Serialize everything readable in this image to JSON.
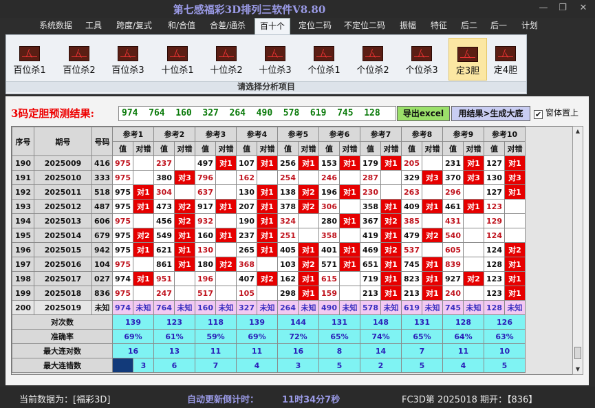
{
  "window": {
    "title": "第七感福彩3D排列三软件V8.80"
  },
  "menu": [
    "系统数据",
    "工具",
    "跨度/复式",
    "和/合值",
    "合差/通杀",
    "百十个",
    "定位二码",
    "不定位二码",
    "振幅",
    "特征",
    "后二",
    "后一",
    "计划"
  ],
  "ribbon": {
    "buttons": [
      "百位杀1",
      "百位杀2",
      "百位杀3",
      "十位杀1",
      "十位杀2",
      "十位杀3",
      "个位杀1",
      "个位杀2",
      "个位杀3",
      "定3胆",
      "定4胆"
    ],
    "caption": "请选择分析项目"
  },
  "prediction": {
    "label": "3码定胆预测结果:",
    "value": "974  764  160  327  264  490  578  619  745  128",
    "excel_button": "导出excel",
    "generate_button": "用结果>生成大底",
    "checkbox_label": "窗体置上",
    "checkbox_checked": true
  },
  "table": {
    "col_headers": [
      "序号",
      "期号",
      "号码"
    ],
    "ref_headers": [
      "参考1",
      "参考2",
      "参考3",
      "参考4",
      "参考5",
      "参考6",
      "参考7",
      "参考8",
      "参考9",
      "参考10"
    ],
    "sub_headers": [
      "值",
      "对错"
    ],
    "rows": [
      {
        "seq": "190",
        "issue": "2025009",
        "num": "416",
        "cells": [
          [
            "975",
            "",
            "r"
          ],
          [
            "237",
            "",
            "r"
          ],
          [
            "497",
            "对1",
            "b"
          ],
          [
            "107",
            "对1",
            "b"
          ],
          [
            "256",
            "对1",
            "b"
          ],
          [
            "153",
            "对1",
            "b"
          ],
          [
            "179",
            "对1",
            "b"
          ],
          [
            "205",
            "",
            "r"
          ],
          [
            "231",
            "对1",
            "b"
          ],
          [
            "127",
            "对1",
            "b"
          ]
        ]
      },
      {
        "seq": "191",
        "issue": "2025010",
        "num": "333",
        "cells": [
          [
            "975",
            "",
            "r"
          ],
          [
            "380",
            "对3",
            "b"
          ],
          [
            "796",
            "",
            "r"
          ],
          [
            "162",
            "",
            "r"
          ],
          [
            "254",
            "",
            "r"
          ],
          [
            "246",
            "",
            "r"
          ],
          [
            "287",
            "",
            "r"
          ],
          [
            "329",
            "对3",
            "b"
          ],
          [
            "370",
            "对3",
            "b"
          ],
          [
            "130",
            "对3",
            "b"
          ]
        ]
      },
      {
        "seq": "192",
        "issue": "2025011",
        "num": "518",
        "cells": [
          [
            "975",
            "对1",
            "b"
          ],
          [
            "304",
            "",
            "r"
          ],
          [
            "637",
            "",
            "r"
          ],
          [
            "130",
            "对1",
            "b"
          ],
          [
            "138",
            "对2",
            "b"
          ],
          [
            "196",
            "对1",
            "b"
          ],
          [
            "230",
            "",
            "r"
          ],
          [
            "263",
            "",
            "r"
          ],
          [
            "296",
            "",
            "r"
          ],
          [
            "127",
            "对1",
            "b"
          ]
        ]
      },
      {
        "seq": "193",
        "issue": "2025012",
        "num": "487",
        "cells": [
          [
            "975",
            "对1",
            "b"
          ],
          [
            "473",
            "对2",
            "b"
          ],
          [
            "917",
            "对1",
            "b"
          ],
          [
            "207",
            "对1",
            "b"
          ],
          [
            "378",
            "对2",
            "b"
          ],
          [
            "306",
            "",
            "r"
          ],
          [
            "358",
            "对1",
            "b"
          ],
          [
            "409",
            "对1",
            "b"
          ],
          [
            "461",
            "对1",
            "b"
          ],
          [
            "123",
            "",
            "r"
          ]
        ]
      },
      {
        "seq": "194",
        "issue": "2025013",
        "num": "606",
        "cells": [
          [
            "975",
            "",
            "r"
          ],
          [
            "456",
            "对2",
            "b"
          ],
          [
            "932",
            "",
            "r"
          ],
          [
            "190",
            "对1",
            "b"
          ],
          [
            "324",
            "",
            "r"
          ],
          [
            "280",
            "对1",
            "b"
          ],
          [
            "367",
            "对2",
            "b"
          ],
          [
            "385",
            "",
            "r"
          ],
          [
            "431",
            "",
            "r"
          ],
          [
            "129",
            "",
            "r"
          ]
        ]
      },
      {
        "seq": "195",
        "issue": "2025014",
        "num": "679",
        "cells": [
          [
            "975",
            "对2",
            "b"
          ],
          [
            "549",
            "对1",
            "b"
          ],
          [
            "160",
            "对1",
            "b"
          ],
          [
            "237",
            "对1",
            "b"
          ],
          [
            "251",
            "",
            "r"
          ],
          [
            "358",
            "",
            "r"
          ],
          [
            "419",
            "对1",
            "b"
          ],
          [
            "479",
            "对2",
            "b"
          ],
          [
            "540",
            "",
            "r"
          ],
          [
            "124",
            "",
            "r"
          ]
        ]
      },
      {
        "seq": "196",
        "issue": "2025015",
        "num": "942",
        "cells": [
          [
            "975",
            "对1",
            "b"
          ],
          [
            "621",
            "对1",
            "b"
          ],
          [
            "130",
            "",
            "r"
          ],
          [
            "265",
            "对1",
            "b"
          ],
          [
            "405",
            "对1",
            "b"
          ],
          [
            "401",
            "对1",
            "b"
          ],
          [
            "469",
            "对2",
            "b"
          ],
          [
            "537",
            "",
            "r"
          ],
          [
            "605",
            "",
            "r"
          ],
          [
            "124",
            "对2",
            "b"
          ]
        ]
      },
      {
        "seq": "197",
        "issue": "2025016",
        "num": "104",
        "cells": [
          [
            "975",
            "",
            "r"
          ],
          [
            "861",
            "对1",
            "b"
          ],
          [
            "180",
            "对2",
            "b"
          ],
          [
            "368",
            "",
            "r"
          ],
          [
            "103",
            "对2",
            "b"
          ],
          [
            "571",
            "对1",
            "b"
          ],
          [
            "651",
            "对1",
            "b"
          ],
          [
            "745",
            "对1",
            "b"
          ],
          [
            "839",
            "",
            "r"
          ],
          [
            "128",
            "对1",
            "b"
          ]
        ]
      },
      {
        "seq": "198",
        "issue": "2025017",
        "num": "027",
        "cells": [
          [
            "974",
            "对1",
            "b"
          ],
          [
            "951",
            "",
            "r"
          ],
          [
            "196",
            "",
            "r"
          ],
          [
            "407",
            "对2",
            "b"
          ],
          [
            "162",
            "对1",
            "b"
          ],
          [
            "615",
            "",
            "r"
          ],
          [
            "719",
            "对1",
            "b"
          ],
          [
            "823",
            "对1",
            "b"
          ],
          [
            "927",
            "对2",
            "b"
          ],
          [
            "123",
            "对1",
            "b"
          ]
        ]
      },
      {
        "seq": "199",
        "issue": "2025018",
        "num": "836",
        "cells": [
          [
            "975",
            "",
            "r"
          ],
          [
            "247",
            "",
            "r"
          ],
          [
            "517",
            "",
            "r"
          ],
          [
            "105",
            "",
            "r"
          ],
          [
            "298",
            "对1",
            "b"
          ],
          [
            "159",
            "",
            "r"
          ],
          [
            "213",
            "对1",
            "b"
          ],
          [
            "213",
            "对1",
            "b"
          ],
          [
            "240",
            "",
            "r"
          ],
          [
            "123",
            "对1",
            "b"
          ]
        ]
      }
    ],
    "pred_row": {
      "seq": "200",
      "issue": "2025019",
      "num": "未知",
      "vals": [
        "974",
        "764",
        "160",
        "327",
        "264",
        "490",
        "578",
        "619",
        "745",
        "128"
      ],
      "unk": "未知"
    },
    "stats": [
      {
        "label": "对次数",
        "vals": [
          "139",
          "123",
          "118",
          "139",
          "144",
          "131",
          "148",
          "131",
          "128",
          "126"
        ]
      },
      {
        "label": "准确率",
        "vals": [
          "69%",
          "61%",
          "59%",
          "69%",
          "72%",
          "65%",
          "74%",
          "65%",
          "64%",
          "63%"
        ]
      },
      {
        "label": "最大连对数",
        "vals": [
          "16",
          "13",
          "11",
          "11",
          "16",
          "8",
          "14",
          "7",
          "11",
          "10"
        ]
      },
      {
        "label": "最大连错数",
        "vals": [
          "3",
          "6",
          "7",
          "4",
          "3",
          "5",
          "2",
          "5",
          "4",
          "5"
        ]
      }
    ]
  },
  "status": {
    "current_data": "当前数据为：[福彩3D]",
    "countdown_label": "自动更新倒计时：",
    "countdown": "11时34分7秒",
    "draw_info": "FC3D第 2025018 期开：【836】"
  },
  "colors": {
    "accent": "#9a9ae6",
    "error_cell": "#e60000",
    "stat_bg": "#7ff3f3",
    "pred_bg": "#f2c9f2",
    "pred_text": "#0a7a0a"
  }
}
